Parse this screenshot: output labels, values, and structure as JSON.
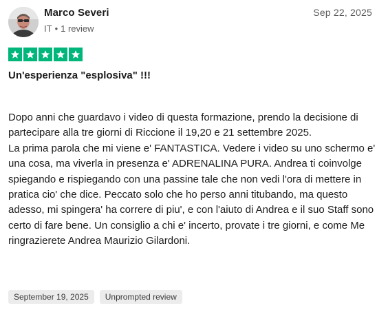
{
  "review": {
    "author": {
      "name": "Marco Severi",
      "country": "IT",
      "review_count": "1 review"
    },
    "date": "Sep 22, 2025",
    "rating": 5,
    "rating_color": "#00b67a",
    "title": "Un'esperienza \"esplosiva\" !!!",
    "body": {
      "paragraph_1": "Dopo anni che guardavo i video di questa formazione, prendo la decisione di partecipare alla tre giorni di Riccione il 19,20 e 21 settembre 2025.",
      "paragraph_2": "La prima parola che mi viene e' FANTASTICA. Vedere i video su uno schermo e' una cosa, ma viverla in presenza e' ADRENALINA PURA. Andrea ti coinvolge spiegando e rispiegando con una passine tale che non vedi l'ora di mettere in pratica cio' che dice. Peccato solo che ho perso anni titubando, ma questo adesso, mi spingera' ha correre di piu', e con l'aiuto di Andrea e il suo Staff sono certo di fare bene. Un consiglio a chi e' incerto, provate i tre giorni, e come Me ringrazierete Andrea Maurizio Gilardoni."
    },
    "tags": {
      "experience_date": "September 19, 2025",
      "review_type": "Unprompted review"
    },
    "icons": {
      "avatar": "user-photo",
      "star": "star-icon"
    }
  }
}
